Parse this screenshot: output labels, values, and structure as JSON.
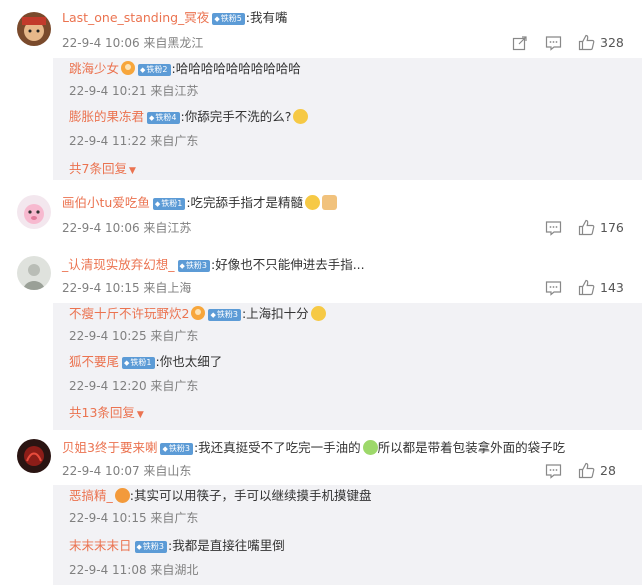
{
  "comments": [
    {
      "user": "Last_one_standing_冥夜",
      "badge": "铁粉5",
      "text": ":我有嘴",
      "meta": "22-9-4 10:06 来自黑龙江",
      "likes": "328",
      "replies": [
        {
          "user": "跳海少女",
          "badge": "铁粉2",
          "text": ":哈哈哈哈哈哈哈哈哈哈",
          "meta": "22-9-4 10:21 来自江苏"
        },
        {
          "user": "膨胀的果冻君",
          "badge": "铁粉4",
          "text": ":你舔完手不洗的么?",
          "meta": "22-9-4 11:22 来自广东"
        }
      ],
      "more": "共7条回复"
    },
    {
      "user": "画伯小tu爱吃鱼",
      "badge": "铁粉1",
      "text": ":吃完舔手指才是精髓",
      "meta": "22-9-4 10:06 来自江苏",
      "likes": "176"
    },
    {
      "user": "_认清现实放弃幻想_",
      "badge": "铁粉3",
      "text": ":好像也不只能伸进去手指...",
      "meta": "22-9-4 10:15 来自上海",
      "likes": "143",
      "replies": [
        {
          "user": "不瘦十斤不许玩野炊2",
          "badge": "铁粉3",
          "text": ":上海扣十分",
          "meta": "22-9-4 10:25 来自广东"
        },
        {
          "user": "狐不要尾",
          "badge": "铁粉1",
          "text": ":你也太细了",
          "meta": "22-9-4 12:20 来自广东"
        }
      ],
      "more": "共13条回复"
    },
    {
      "user": "贝姐3终于要来喇",
      "badge": "铁粉3",
      "text": ":我还真挺受不了吃完一手油的",
      "text2": "所以都是带着包装拿外面的袋子吃",
      "meta": "22-9-4 10:07 来自山东",
      "likes": "28",
      "replies": [
        {
          "user": "恶搞精_",
          "text": ":其实可以用筷子，手可以继续摸手机摸键盘",
          "meta": "22-9-4 10:15 来自广东"
        },
        {
          "user": "末末末末日",
          "badge": "铁粉3",
          "text": ":我都是直接往嘴里倒",
          "meta": "22-9-4 11:08 来自湖北"
        }
      ]
    }
  ],
  "icons": [
    "share-icon",
    "comment-icon",
    "like-icon"
  ],
  "colors": {
    "username": "#eb7350",
    "meta": "#808080",
    "reply_bg": "#f2f2f5",
    "badge": "#5c9bd6"
  }
}
